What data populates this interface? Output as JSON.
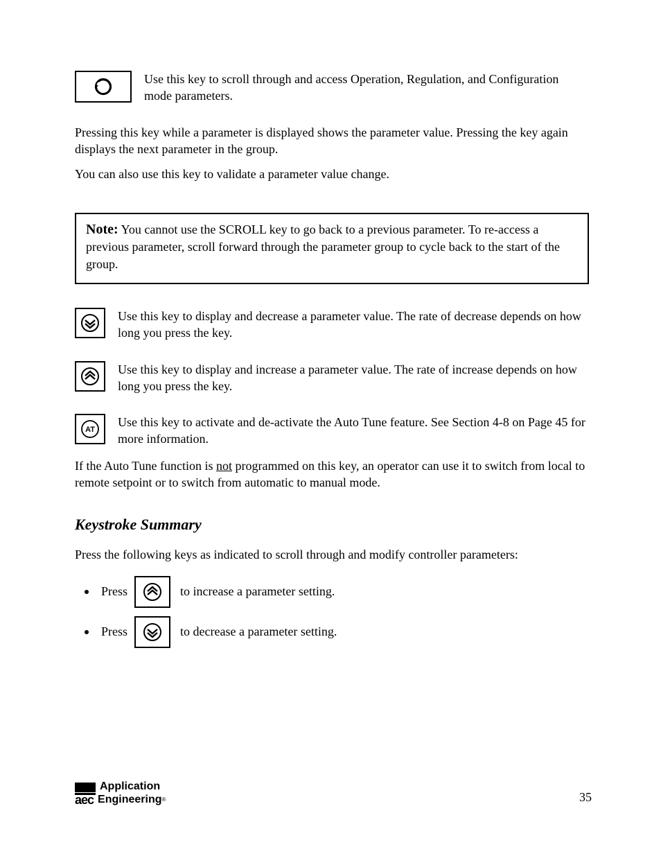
{
  "keys": {
    "return": {
      "definition": "Use this key to scroll through and access Operation, Regulation, and Configuration mode parameters.",
      "additional": "Pressing this key while a parameter is displayed shows the parameter value. Pressing the key again displays the next parameter in the group.",
      "additional2": "You can also use this key to validate a parameter value change."
    },
    "down": {
      "definition": "Use this key to display and decrease a parameter value. The rate of decrease depends on how long you press the key."
    },
    "up": {
      "definition": "Use this key to display and increase a parameter value. The rate of increase depends on how long you press the key."
    },
    "at": {
      "definition": "Use this key to activate and de-activate the Auto Tune feature. See Section 4-8 on Page 45 for more information.",
      "additional_lead": "If the Auto Tune function is ",
      "additional_not": "not",
      "additional_rest": " programmed on this key, an operator can use it to switch from local to remote setpoint or to switch from automatic to manual mode."
    }
  },
  "note": {
    "label": "Note:",
    "text": " You cannot use the SCROLL key to go back to a previous parameter. To re-access a previous parameter, scroll forward through the parameter group to cycle back to the start of the group."
  },
  "section": {
    "heading": "Keystroke Summary",
    "para": "Press the following keys as indicated to scroll through and modify controller parameters:",
    "bullets": [
      {
        "pre": "Press",
        "icon": "up",
        "post": "to increase a parameter setting."
      },
      {
        "pre": "Press",
        "icon": "down",
        "post": "to decrease a parameter setting."
      }
    ]
  },
  "logo": {
    "top": "Application",
    "aec": "aec",
    "bottom": "Engineering",
    "sub": "®"
  },
  "page_number": "35"
}
